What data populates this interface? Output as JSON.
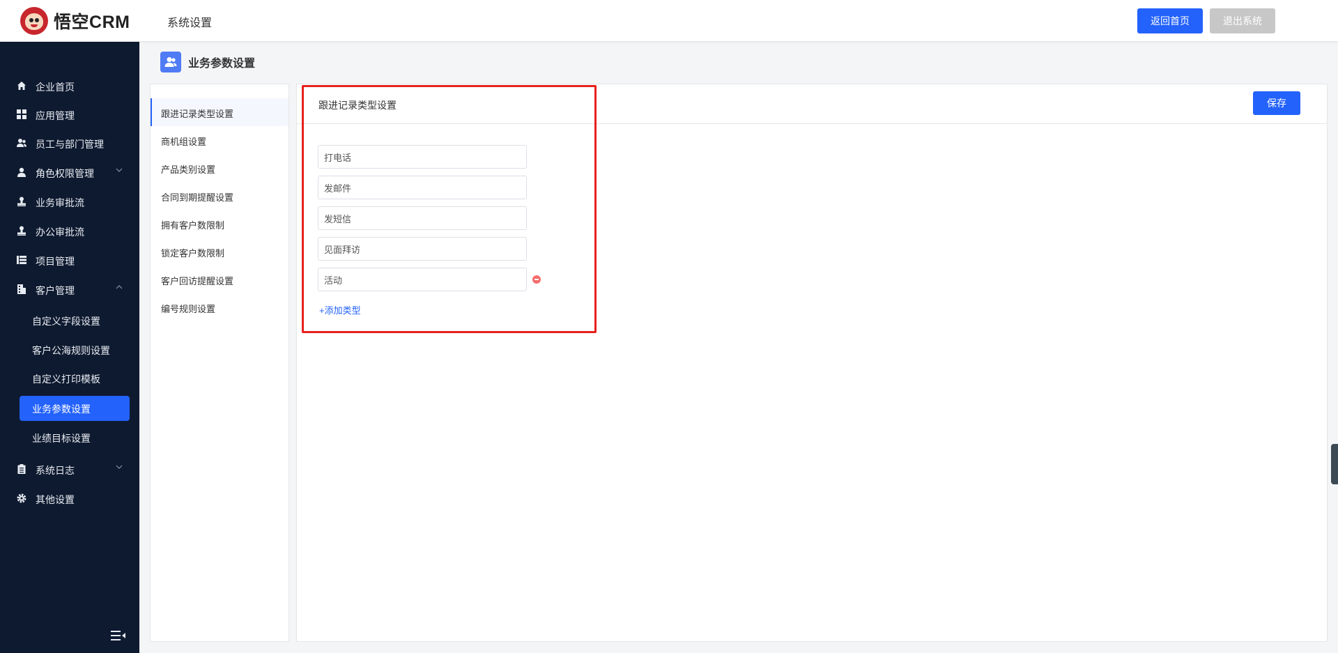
{
  "header": {
    "logo_cn": "悟空",
    "logo_en": "CRM",
    "section_title": "系统设置",
    "home_button": "返回首页",
    "exit_button": "退出系统"
  },
  "sidebar": {
    "items": [
      {
        "label": "企业首页",
        "icon": "home-icon"
      },
      {
        "label": "应用管理",
        "icon": "grid-icon"
      },
      {
        "label": "员工与部门管理",
        "icon": "users-icon"
      },
      {
        "label": "角色权限管理",
        "icon": "user-icon",
        "chevron": "down"
      },
      {
        "label": "业务审批流",
        "icon": "stamp-icon"
      },
      {
        "label": "办公审批流",
        "icon": "stamp-icon"
      },
      {
        "label": "项目管理",
        "icon": "list-icon"
      },
      {
        "label": "客户管理",
        "icon": "building-icon",
        "chevron": "up"
      },
      {
        "label": "系统日志",
        "icon": "clipboard-icon",
        "chevron": "down"
      },
      {
        "label": "其他设置",
        "icon": "gear-icon"
      }
    ],
    "sub_items": [
      {
        "label": "自定义字段设置"
      },
      {
        "label": "客户公海规则设置"
      },
      {
        "label": "自定义打印模板"
      },
      {
        "label": "业务参数设置",
        "active": true
      },
      {
        "label": "业绩目标设置"
      }
    ]
  },
  "page": {
    "title": "业务参数设置"
  },
  "settings_menu": {
    "items": [
      {
        "label": "跟进记录类型设置",
        "active": true
      },
      {
        "label": "商机组设置"
      },
      {
        "label": "产品类别设置"
      },
      {
        "label": "合同到期提醒设置"
      },
      {
        "label": "拥有客户数限制"
      },
      {
        "label": "锁定客户数限制"
      },
      {
        "label": "客户回访提醒设置"
      },
      {
        "label": "编号规则设置"
      }
    ]
  },
  "content": {
    "title": "跟进记录类型设置",
    "save_button": "保存",
    "types": [
      "打电话",
      "发邮件",
      "发短信",
      "见面拜访",
      "活动"
    ],
    "add_link": "+添加类型"
  },
  "colors": {
    "accent": "#2362fb",
    "sidebar_bg": "#0e1a2f",
    "highlight": "#e5211d",
    "remove": "#f56c6c"
  }
}
